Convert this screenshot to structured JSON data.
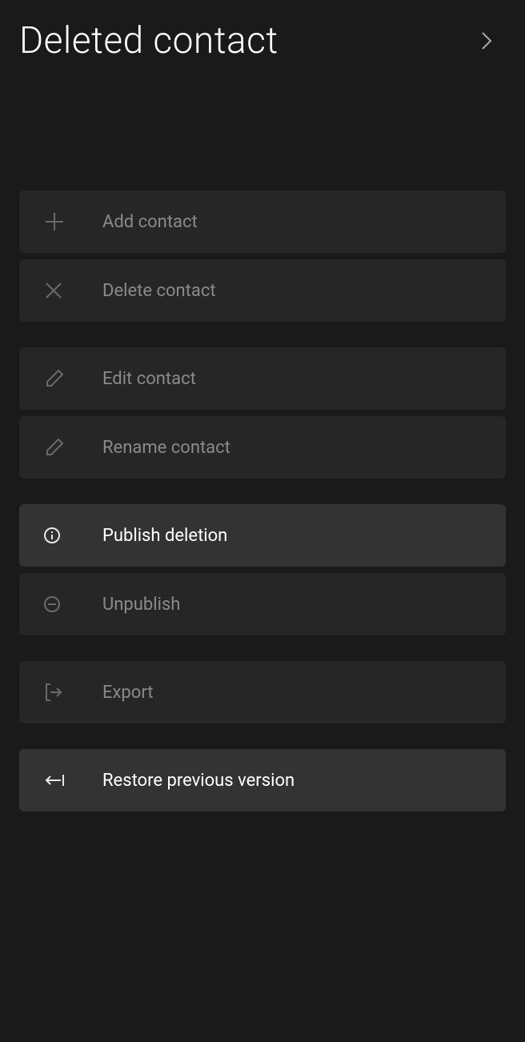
{
  "header": {
    "title": "Deleted contact"
  },
  "groups": [
    {
      "items": [
        {
          "label": "Add contact"
        },
        {
          "label": "Delete contact"
        }
      ]
    },
    {
      "items": [
        {
          "label": "Edit contact"
        },
        {
          "label": "Rename contact"
        }
      ]
    },
    {
      "items": [
        {
          "label": "Publish deletion"
        },
        {
          "label": "Unpublish"
        }
      ]
    },
    {
      "items": [
        {
          "label": "Export"
        }
      ]
    },
    {
      "items": [
        {
          "label": "Restore previous version"
        }
      ]
    }
  ]
}
